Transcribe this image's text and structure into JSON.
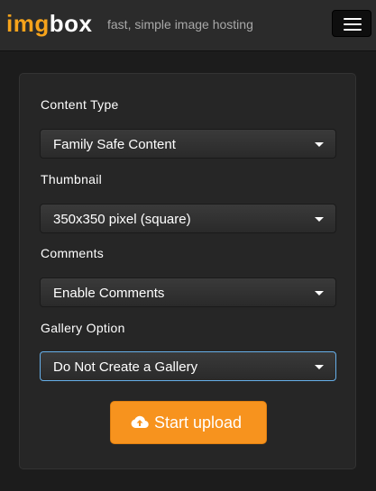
{
  "header": {
    "logo_part1": "img",
    "logo_part2": "box",
    "tagline": "fast, simple image hosting",
    "menu_icon": "hamburger-menu-icon"
  },
  "colors": {
    "brand_orange": "#f6a31b",
    "button_orange": "#f7931e",
    "focus_blue": "#66afe9"
  },
  "form": {
    "content_type": {
      "label": "Content Type",
      "value": "Family Safe Content"
    },
    "thumbnail": {
      "label": "Thumbnail",
      "value": "350x350 pixel (square)"
    },
    "comments": {
      "label": "Comments",
      "value": "Enable Comments"
    },
    "gallery": {
      "label": "Gallery Option",
      "value": "Do Not Create a Gallery"
    },
    "upload_button": {
      "label": "Start upload",
      "icon": "cloud-upload-icon"
    }
  }
}
